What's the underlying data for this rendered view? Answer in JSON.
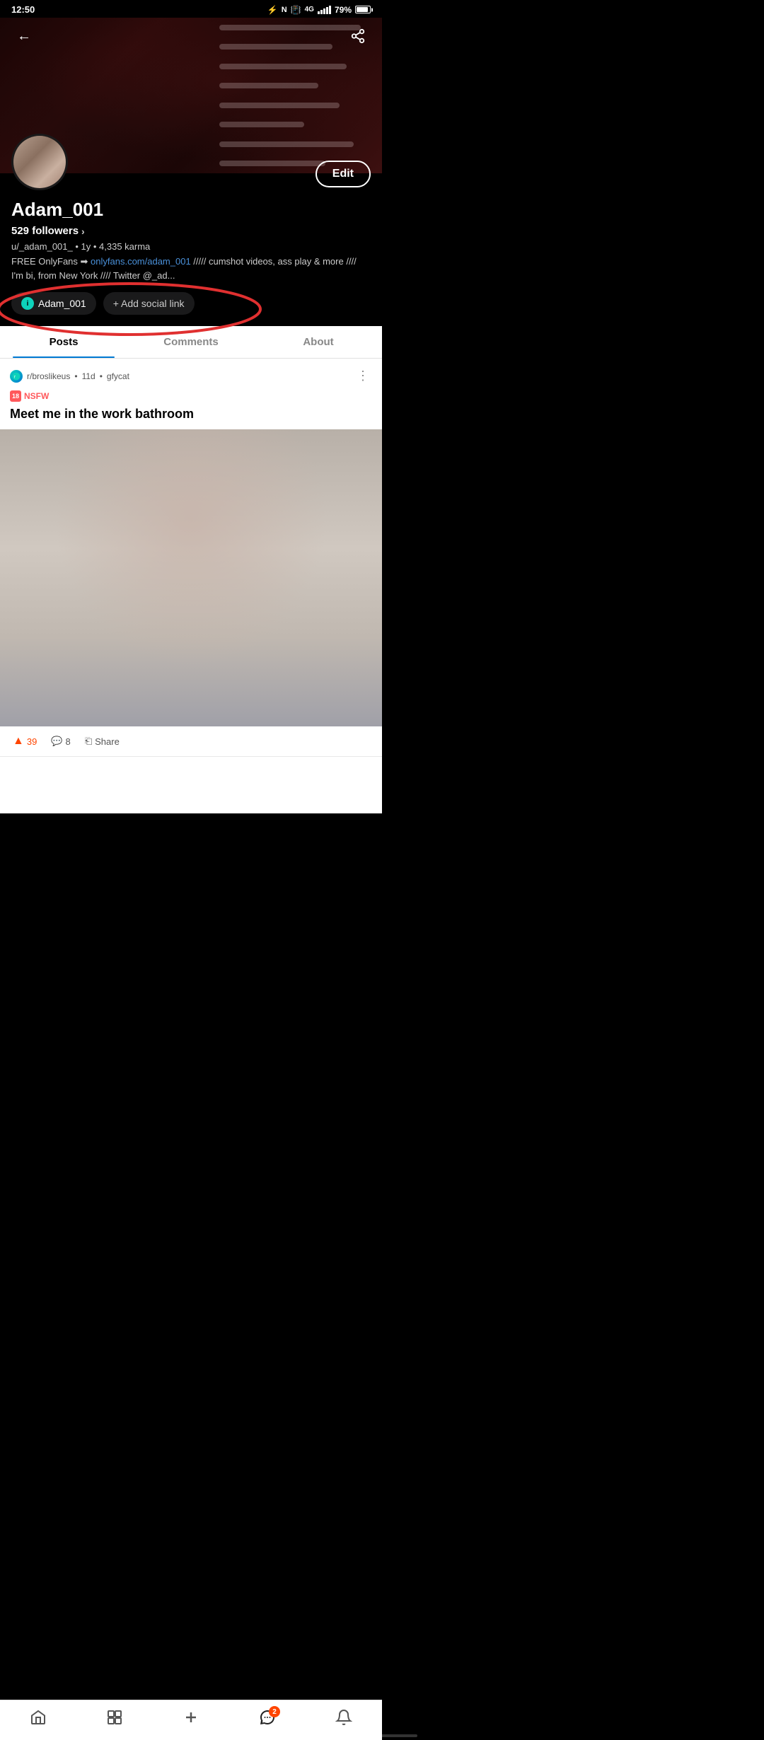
{
  "statusBar": {
    "time": "12:50",
    "battery": "79%",
    "batteryPct": 79
  },
  "header": {
    "backLabel": "←",
    "shareLabel": "⎘"
  },
  "profile": {
    "username": "Adam_001",
    "followers": "529 followers",
    "meta": "u/_adam_001_ • 1y • 4,335 karma",
    "bio": "FREE OnlyFans ➡ onlyfans.com/adam_001 ///// cumshot videos, ass play & more //// I'm bi, from New York //// Twitter @_ad...",
    "bioLink": "onlyfans.com/adam_001",
    "editLabel": "Edit",
    "socialHandle": "Adam_001",
    "addSocialLabel": "+ Add social link"
  },
  "tabs": {
    "posts": "Posts",
    "comments": "Comments",
    "about": "About"
  },
  "post": {
    "subreddit": "r/broslikeus",
    "age": "11d",
    "source": "gfycat",
    "nsfwLabel": "NSFW",
    "title": "Meet me in the work bathroom",
    "upvoteCount": "39",
    "commentCount": "8",
    "shareLabel": "Share"
  },
  "bottomNav": {
    "home": "⌂",
    "feed": "⊞",
    "create": "+",
    "messages": "💬",
    "messageBadge": "2",
    "bell": "🔔"
  }
}
